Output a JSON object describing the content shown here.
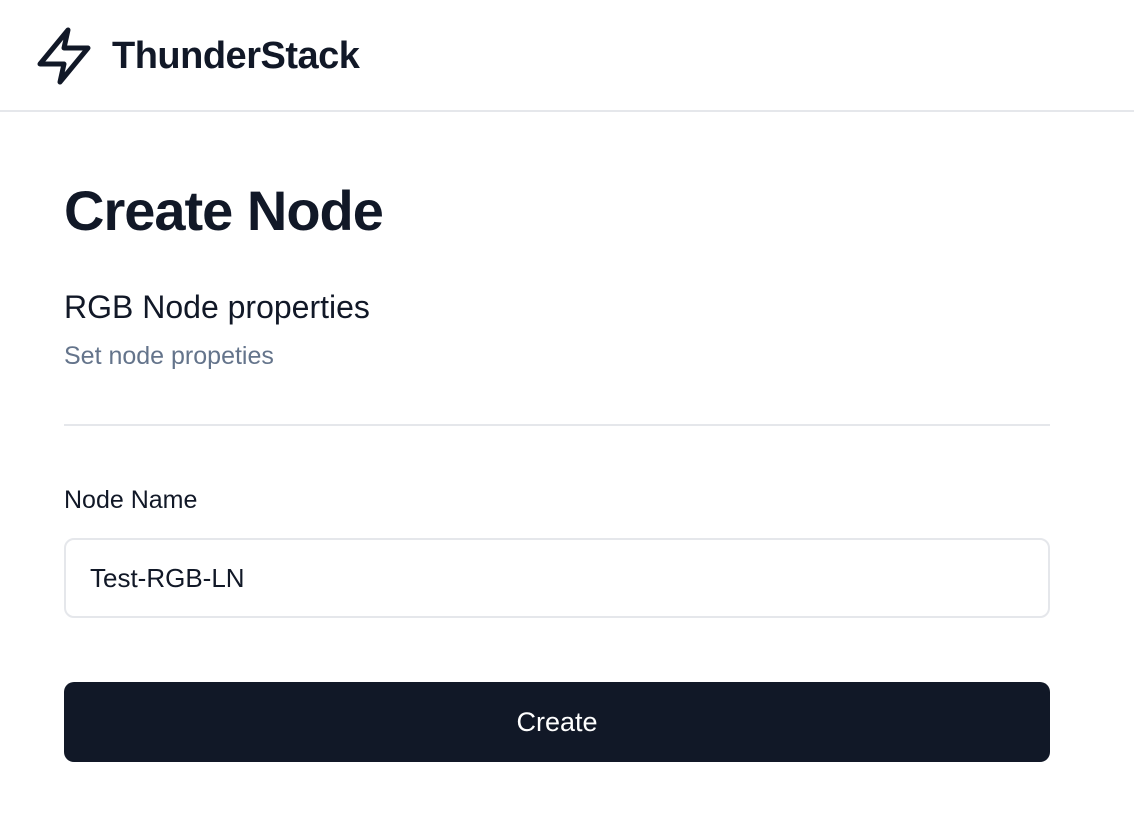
{
  "header": {
    "brand": "ThunderStack",
    "logo_icon": "lightning-bolt-icon"
  },
  "page": {
    "title": "Create Node"
  },
  "section": {
    "title": "RGB Node properties",
    "subtitle": "Set node propeties"
  },
  "form": {
    "node_name_label": "Node Name",
    "node_name_value": "Test-RGB-LN",
    "submit_label": "Create"
  },
  "colors": {
    "primary": "#111827",
    "muted_text": "#64748b",
    "border": "#e5e7eb"
  }
}
